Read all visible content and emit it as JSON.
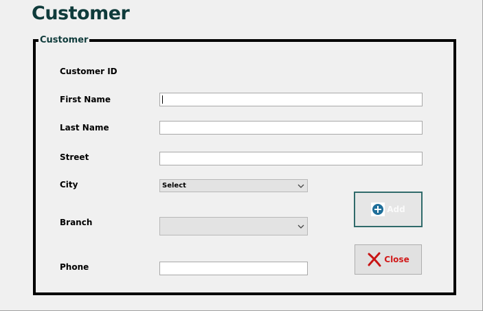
{
  "header": {
    "title": "Customer"
  },
  "form": {
    "legend": "Customer",
    "fields": {
      "customer_id": {
        "label": "Customer ID"
      },
      "first_name": {
        "label": "First Name",
        "value": ""
      },
      "last_name": {
        "label": "Last Name",
        "value": ""
      },
      "street": {
        "label": "Street",
        "value": ""
      },
      "city": {
        "label": "City",
        "selected": "Select"
      },
      "branch": {
        "label": "Branch",
        "selected": ""
      },
      "phone": {
        "label": "Phone",
        "value": ""
      }
    },
    "buttons": {
      "add_label": "Add",
      "close_label": "Close"
    }
  },
  "icons": {
    "add": "plus-circle-icon",
    "close": "red-x-icon",
    "dropdown": "chevron-down-icon"
  },
  "colors": {
    "title": "#0f3b3b",
    "add_icon": "#1f6f9a",
    "close_text": "#d11a1a",
    "add_border": "#2f6a6a"
  }
}
